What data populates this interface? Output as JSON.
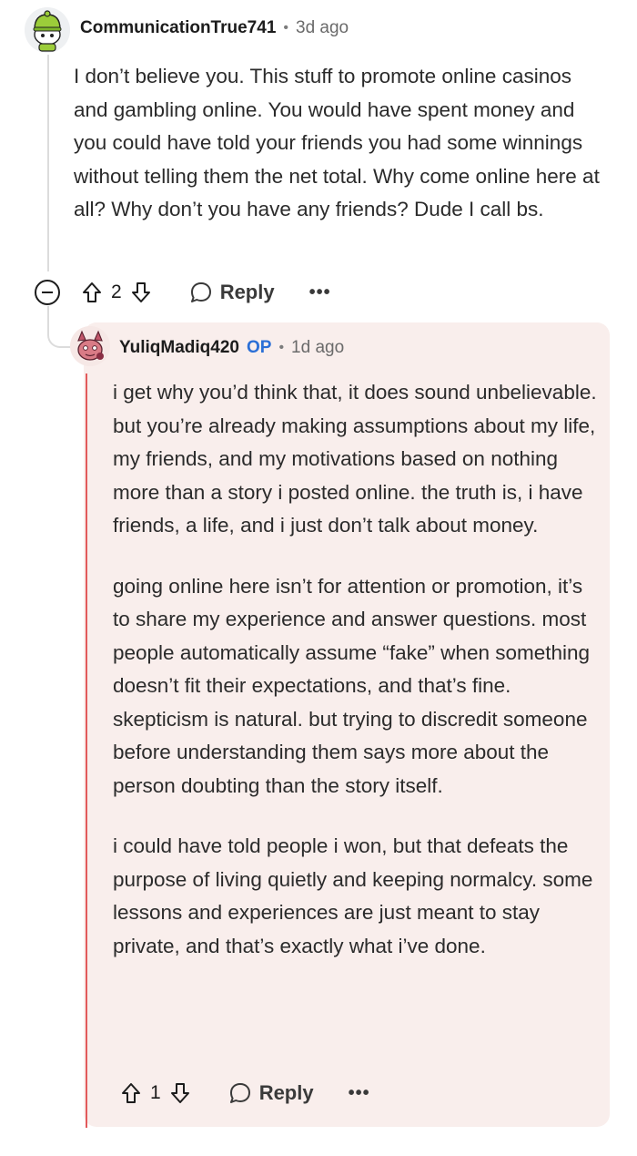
{
  "parent": {
    "username": "CommunicationTrue741",
    "separator": "•",
    "time": "3d ago",
    "body": "I don’t believe you. This stuff to promote online casinos and gambling online. You would have spent money and you could have told your friends you had some winnings without telling them the net total. Why come online here at all? Why don’t you have any friends? Dude I call bs.",
    "votes": "2",
    "reply_label": "Reply",
    "more_label": "•••"
  },
  "reply": {
    "username": "YuliqMadiq420",
    "op_badge": "OP",
    "separator": "•",
    "time": "1d ago",
    "paragraphs": [
      "i get why you’d think that, it does sound unbelievable. but you’re already making assumptions about my life, my friends, and my motivations based on nothing more than a story i posted online. the truth is, i have friends, a life, and i just don’t talk about money.",
      "going online here isn’t for attention or promotion, it’s to share my experience and answer questions. most people automatically assume “fake” when something doesn’t fit their expectations, and that’s fine. skepticism is natural. but trying to discredit someone before understanding them says more about the person doubting than the story itself.",
      "i could have told people i won, but that defeats the purpose of living quietly and keeping normalcy. some lessons and experiences are just meant to stay private, and that’s exactly what i’ve done."
    ],
    "votes": "1",
    "reply_label": "Reply",
    "more_label": "•••"
  },
  "colors": {
    "op_highlight_bg": "#f9eeec",
    "op_thread_line": "#e2595b",
    "op_badge": "#2b6fd6",
    "thread_line": "#dcdcdc"
  },
  "icons": {
    "parent_avatar": "snoo-avatar-green-hat",
    "op_avatar": "snoo-avatar-pink-creature",
    "upvote": "arrow-up-outline-icon",
    "downvote": "arrow-down-outline-icon",
    "reply": "speech-bubble-icon",
    "collapse": "minus-circle-icon",
    "more": "ellipsis-icon"
  }
}
